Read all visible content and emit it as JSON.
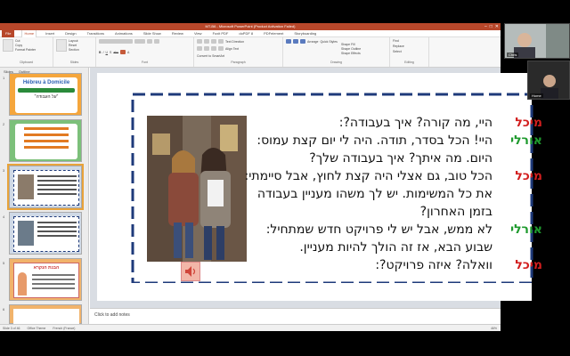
{
  "window": {
    "title": "MT-B6 - Microsoft PowerPoint (Product Activation Failed)",
    "controls": [
      "–",
      "□",
      "✕"
    ]
  },
  "ribbon": {
    "tabs": [
      "File",
      "Home",
      "Insert",
      "Design",
      "Transitions",
      "Animations",
      "Slide Show",
      "Review",
      "View",
      "Foxit PDF",
      "doPDF 8",
      "PDFelement",
      "Storyboarding"
    ],
    "active_tab": "Home",
    "groups": [
      {
        "name": "Clipboard",
        "items": [
          "Paste",
          "Cut",
          "Copy",
          "Format Painter"
        ]
      },
      {
        "name": "Slides",
        "items": [
          "New Slide",
          "Layout",
          "Reset",
          "Section"
        ]
      },
      {
        "name": "Font",
        "items": [
          "B",
          "I",
          "U",
          "S",
          "abc",
          "A"
        ]
      },
      {
        "name": "Paragraph",
        "items": [
          "Text Direction",
          "Align Text",
          "Convert to SmartArt"
        ]
      },
      {
        "name": "Drawing",
        "items": [
          "Arrange",
          "Quick Styles",
          "Shape Fill",
          "Shape Outline",
          "Shape Effects"
        ]
      },
      {
        "name": "Editing",
        "items": [
          "Find",
          "Replace",
          "Select"
        ]
      }
    ]
  },
  "left_panel": {
    "tabs": [
      "Slides",
      "Outline"
    ],
    "thumbnails": [
      {
        "number": "1",
        "title": "Hébreu à Domicile",
        "subtitle": "\"על העבודה\"",
        "theme": "orange"
      },
      {
        "number": "2",
        "title": "",
        "subtitle": "",
        "theme": "green"
      },
      {
        "number": "3",
        "title": "",
        "subtitle": "",
        "theme": "dialog"
      },
      {
        "number": "4",
        "title": "",
        "subtitle": "",
        "theme": "dialog"
      },
      {
        "number": "5",
        "title": "הבנת הנקרא",
        "subtitle": "",
        "theme": "orange"
      },
      {
        "number": "6",
        "title": "",
        "subtitle": "",
        "theme": "orange"
      }
    ],
    "selected": "3"
  },
  "slide": {
    "dialog": [
      {
        "speaker": "מיכל",
        "color": "#d21f1f",
        "text": "היי, מה קורה? איך בעבודה?:"
      },
      {
        "speaker": "אורלי",
        "color": "#1f9a2e",
        "text": "היי! הכל בסדר, תודה. היה לי יום קצת עמוס:"
      },
      {
        "speaker": "",
        "color": "",
        "text": "היום. מה איתך? איך בעבודה שלך?"
      },
      {
        "speaker": "מיכל",
        "color": "#d21f1f",
        "text": "הכל טוב, גם אצלי היה קצת לחוץ, אבל סיימתי:"
      },
      {
        "speaker": "",
        "color": "",
        "text": "את כל המשימות. יש לך משהו מעניין בעבודה"
      },
      {
        "speaker": "",
        "color": "",
        "text": "בזמן האחרון?"
      },
      {
        "speaker": "אורלי",
        "color": "#1f9a2e",
        "text": "לא ממש, אבל יש לי פרויקט חדש שמתחיל:"
      },
      {
        "speaker": "",
        "color": "",
        "text": "שבוע הבא, אז זה הולך להיות מעניין."
      },
      {
        "speaker": "מיכל",
        "color": "#d21f1f",
        "text": "וואלה? איזה פרויקט?:"
      }
    ]
  },
  "notes": {
    "placeholder": "Click to add notes"
  },
  "status": {
    "slide": "Slide 3 of 46",
    "theme": "Office Theme",
    "language": "French (France)",
    "zoom": "46%"
  },
  "video": {
    "tiles": [
      {
        "name": "Chris"
      },
      {
        "name": "Home"
      }
    ]
  }
}
